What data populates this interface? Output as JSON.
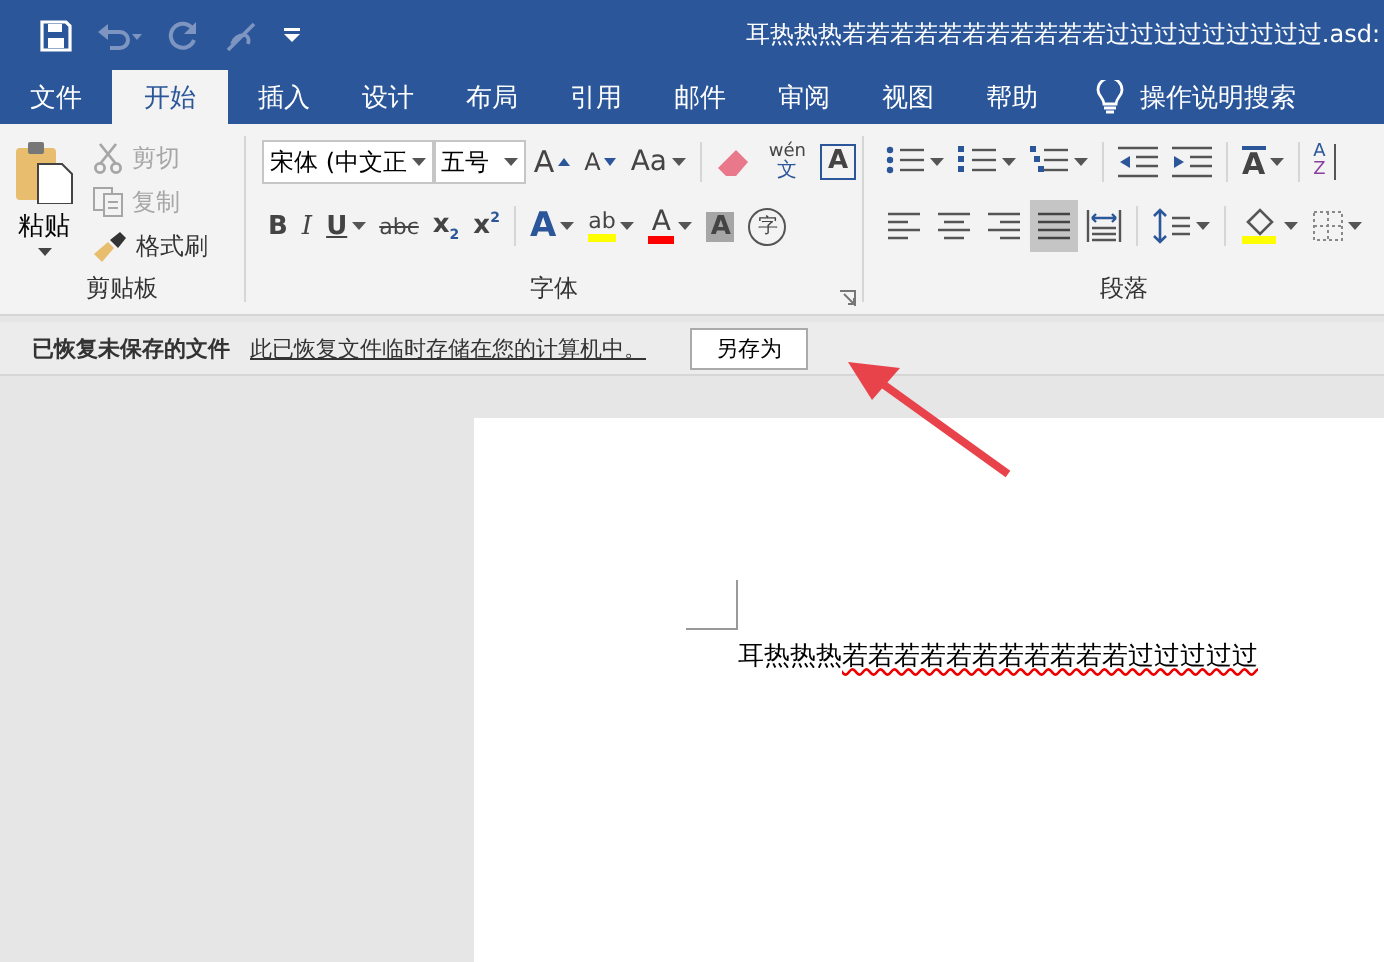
{
  "window": {
    "title": "耳热热热若若若若若若若若若若若过过过过过过过过过.asd:"
  },
  "tabs": [
    {
      "label": "文件",
      "selected": false
    },
    {
      "label": "开始",
      "selected": true
    },
    {
      "label": "插入",
      "selected": false
    },
    {
      "label": "设计",
      "selected": false
    },
    {
      "label": "布局",
      "selected": false
    },
    {
      "label": "引用",
      "selected": false
    },
    {
      "label": "邮件",
      "selected": false
    },
    {
      "label": "审阅",
      "selected": false
    },
    {
      "label": "视图",
      "selected": false
    },
    {
      "label": "帮助",
      "selected": false
    }
  ],
  "tell_me": {
    "placeholder": "操作说明搜索"
  },
  "clipboard": {
    "label": "剪贴板",
    "paste": "粘贴",
    "items": [
      {
        "kind": "cut",
        "label": "剪切",
        "disabled": true
      },
      {
        "kind": "copy",
        "label": "复制",
        "disabled": true
      },
      {
        "kind": "painter",
        "label": "格式刷",
        "disabled": false
      }
    ]
  },
  "font": {
    "label": "字体",
    "font_name": "宋体 (中文正",
    "font_size": "五号",
    "row1": [
      {
        "kind": "grow",
        "text": "A",
        "dropdown": false
      },
      {
        "kind": "shrink",
        "text": "A",
        "dropdown": false
      },
      {
        "kind": "case",
        "text": "Aa",
        "dropdown": true
      },
      {
        "kind": "clear",
        "dropdown": false
      },
      {
        "kind": "pinyin",
        "text": "wén",
        "sub": "文",
        "dropdown": false
      },
      {
        "kind": "border",
        "text": "A",
        "dropdown": false
      }
    ],
    "row2": [
      {
        "kind": "bold",
        "text": "B",
        "dropdown": false
      },
      {
        "kind": "italic",
        "text": "I",
        "dropdown": false
      },
      {
        "kind": "underline",
        "text": "U",
        "dropdown": true
      },
      {
        "kind": "strike",
        "text": "abc",
        "dropdown": false
      },
      {
        "kind": "sub",
        "text": "x",
        "sub": "2",
        "dropdown": false
      },
      {
        "kind": "sup",
        "text": "x",
        "sub": "2",
        "dropdown": false
      },
      {
        "kind": "effect",
        "text": "A",
        "dropdown": true
      },
      {
        "kind": "highlight",
        "text": "ab",
        "dropdown": true
      },
      {
        "kind": "color",
        "text": "A",
        "dropdown": true
      },
      {
        "kind": "shade",
        "text": "A",
        "dropdown": false
      },
      {
        "kind": "enclose",
        "text": "字",
        "dropdown": false
      }
    ]
  },
  "paragraph": {
    "label": "段落",
    "row1": [
      {
        "kind": "bullets",
        "dropdown": true
      },
      {
        "kind": "numbering",
        "dropdown": true
      },
      {
        "kind": "multilevel",
        "dropdown": true
      },
      {
        "kind": "outdent",
        "dropdown": false
      },
      {
        "kind": "indent",
        "dropdown": false
      },
      {
        "kind": "asian",
        "text": "A",
        "dropdown": true
      },
      {
        "kind": "sort",
        "text": "A",
        "sub": "Z",
        "dropdown": false
      }
    ],
    "row2": [
      {
        "kind": "left",
        "selected": false,
        "dropdown": false
      },
      {
        "kind": "center",
        "selected": false,
        "dropdown": false
      },
      {
        "kind": "right",
        "selected": false,
        "dropdown": false
      },
      {
        "kind": "justify",
        "selected": true,
        "dropdown": false
      },
      {
        "kind": "distributed",
        "selected": false,
        "dropdown": false
      },
      {
        "kind": "spacing",
        "selected": false,
        "dropdown": true
      },
      {
        "kind": "shading",
        "selected": false,
        "dropdown": true
      },
      {
        "kind": "borders",
        "selected": false,
        "dropdown": true
      }
    ]
  },
  "info_bar": {
    "title": "已恢复未保存的文件",
    "message": "此已恢复文件临时存储在您的计算机中。",
    "button": "另存为"
  },
  "document": {
    "segments": [
      {
        "text": "耳热热热",
        "spell_error": false
      },
      {
        "text": "若若若若若若若若若若若过过过过过",
        "spell_error": true
      }
    ]
  }
}
